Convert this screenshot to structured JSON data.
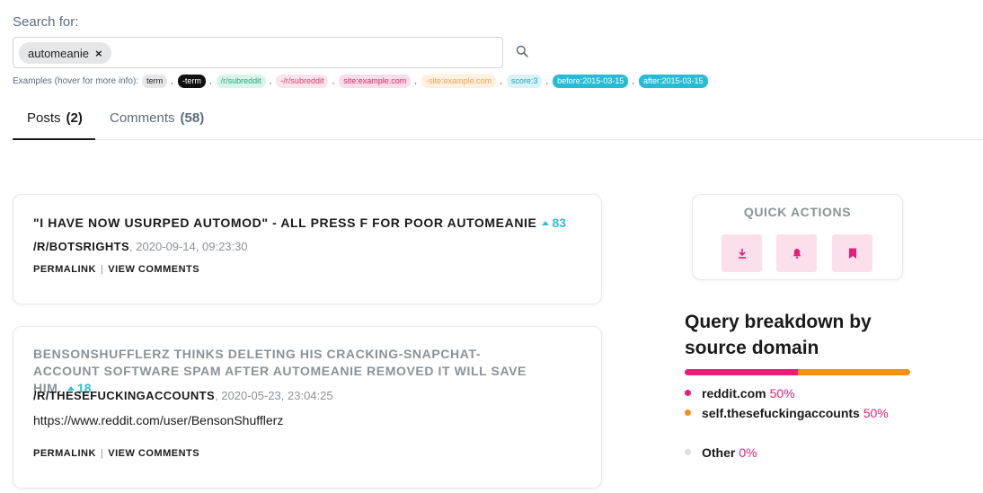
{
  "search": {
    "label": "Search for:",
    "chip": "automeanie",
    "chip_remove": "×",
    "examples_label": "Examples (hover for more info):",
    "examples": [
      {
        "text": "term",
        "bg": "#e4e6e8",
        "fg": "#222222"
      },
      {
        "text": "-term",
        "bg": "#111111",
        "fg": "#ffffff"
      },
      {
        "text": "/r/subreddit",
        "bg": "#d9f5ea",
        "fg": "#1fa57a"
      },
      {
        "text": "-/r/subreddit",
        "bg": "#fde4ec",
        "fg": "#d63a6a"
      },
      {
        "text": "site:example.com",
        "bg": "#fbdde9",
        "fg": "#d4246a"
      },
      {
        "text": "-site:example.com",
        "bg": "#fff0e0",
        "fg": "#f2a34a"
      },
      {
        "text": "score:3",
        "bg": "#d9f3f8",
        "fg": "#1aa3c0"
      },
      {
        "text": "before:2015-03-15",
        "bg": "#27bcd6",
        "fg": "#ffffff"
      },
      {
        "text": "after:2015-03-15",
        "bg": "#27bcd6",
        "fg": "#ffffff"
      }
    ]
  },
  "tabs": [
    {
      "label": "Posts",
      "count": "(2)"
    },
    {
      "label": "Comments",
      "count": "(58)"
    }
  ],
  "posts": [
    {
      "title": "\"I have now usurped AutoMod\" - All press F for poor AutoMeanie",
      "score": "83",
      "subreddit": "/R/BOTSRIGHTS",
      "date": ", 2020-09-14, 09:23:30",
      "selftext": "",
      "permalink": "PERMALINK",
      "divider": "|",
      "view_comments": "VIEW COMMENTS"
    },
    {
      "title": "BensonShufflerz thinks deleting his cracking-snapchat-account software spam after AutoMeanie removed it will save him.",
      "score": "18",
      "subreddit": "/R/THESEFUCKINGACCOUNTS",
      "date": ", 2020-05-23, 23:04:25",
      "selftext": "https://www.reddit.com/user/BensonShufflerz",
      "permalink": "PERMALINK",
      "divider": "|",
      "view_comments": "VIEW COMMENTS"
    }
  ],
  "quick_actions": {
    "title": "QUICK ACTIONS",
    "icons": [
      "download-icon",
      "bell-icon",
      "bookmark-icon"
    ]
  },
  "breakdown": {
    "title": "Query breakdown by source domain",
    "items": [
      {
        "name": "reddit.com",
        "pct": "50%",
        "share": 0.5,
        "color": "#e91e7a"
      },
      {
        "name": "self.thesefuckingaccounts",
        "pct": "50%",
        "share": 0.5,
        "color": "#f59010"
      },
      {
        "name": "Other",
        "pct": "0%",
        "share": 0,
        "color": "#dcdfe2"
      }
    ]
  },
  "colors": {
    "accent": "#e91e7a",
    "score": "#2bbfd9",
    "orange": "#f59010"
  }
}
